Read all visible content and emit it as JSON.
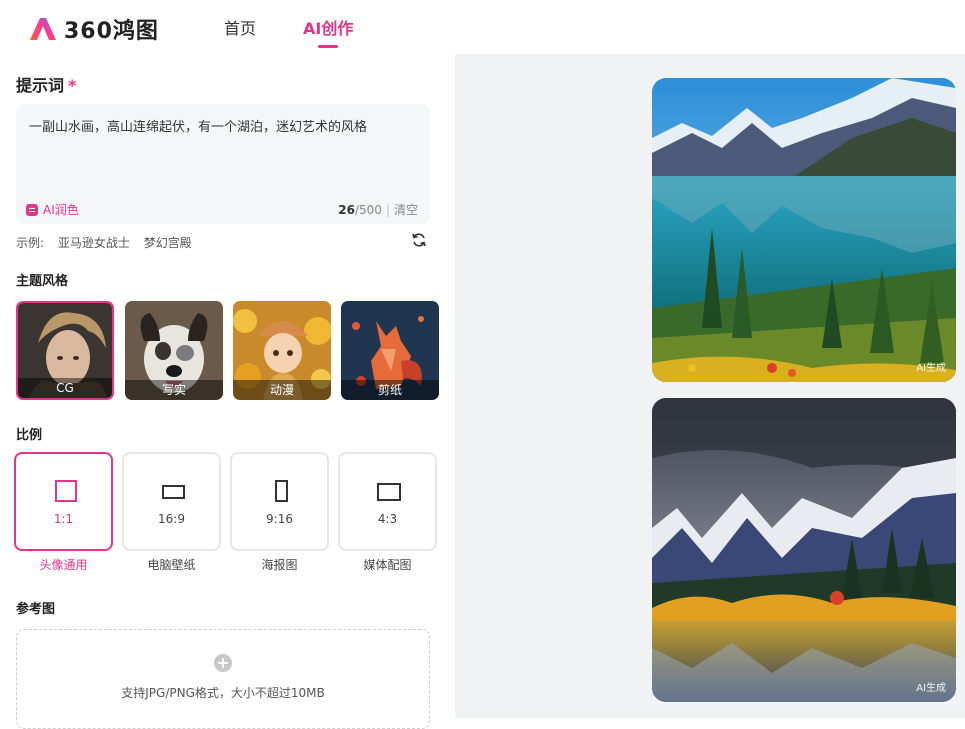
{
  "brand": {
    "logo_text": "360鸿图"
  },
  "nav": {
    "items": [
      {
        "label": "首页"
      },
      {
        "label": "AI创作"
      }
    ]
  },
  "prompt": {
    "title": "提示词",
    "required_mark": "*",
    "value": "一副山水画，高山连绵起伏，有一个湖泊，迷幻艺术的风格",
    "polish_label": "AI润色",
    "count": "26",
    "max": "/500",
    "clear_label": "清空",
    "examples_prefix": "示例:",
    "examples": [
      "亚马逊女战士",
      "梦幻宫殿"
    ]
  },
  "style_section": {
    "title": "主题风格",
    "items": [
      {
        "label": "CG",
        "selected": true
      },
      {
        "label": "写实",
        "selected": false
      },
      {
        "label": "动漫",
        "selected": false
      },
      {
        "label": "剪纸",
        "selected": false
      }
    ]
  },
  "ratio_section": {
    "title": "比例",
    "items": [
      {
        "value": "1:1",
        "name": "头像通用",
        "selected": true
      },
      {
        "value": "16:9",
        "name": "电脑壁纸",
        "selected": false
      },
      {
        "value": "9:16",
        "name": "海报图",
        "selected": false
      },
      {
        "value": "4:3",
        "name": "媒体配图",
        "selected": false
      }
    ]
  },
  "reference": {
    "title": "参考图",
    "hint": "支持JPG/PNG格式，大小不超过10MB"
  },
  "results": {
    "badge": "AI生成"
  },
  "colors": {
    "accent": "#e8338a",
    "panel_bg": "#f1f2f4"
  }
}
